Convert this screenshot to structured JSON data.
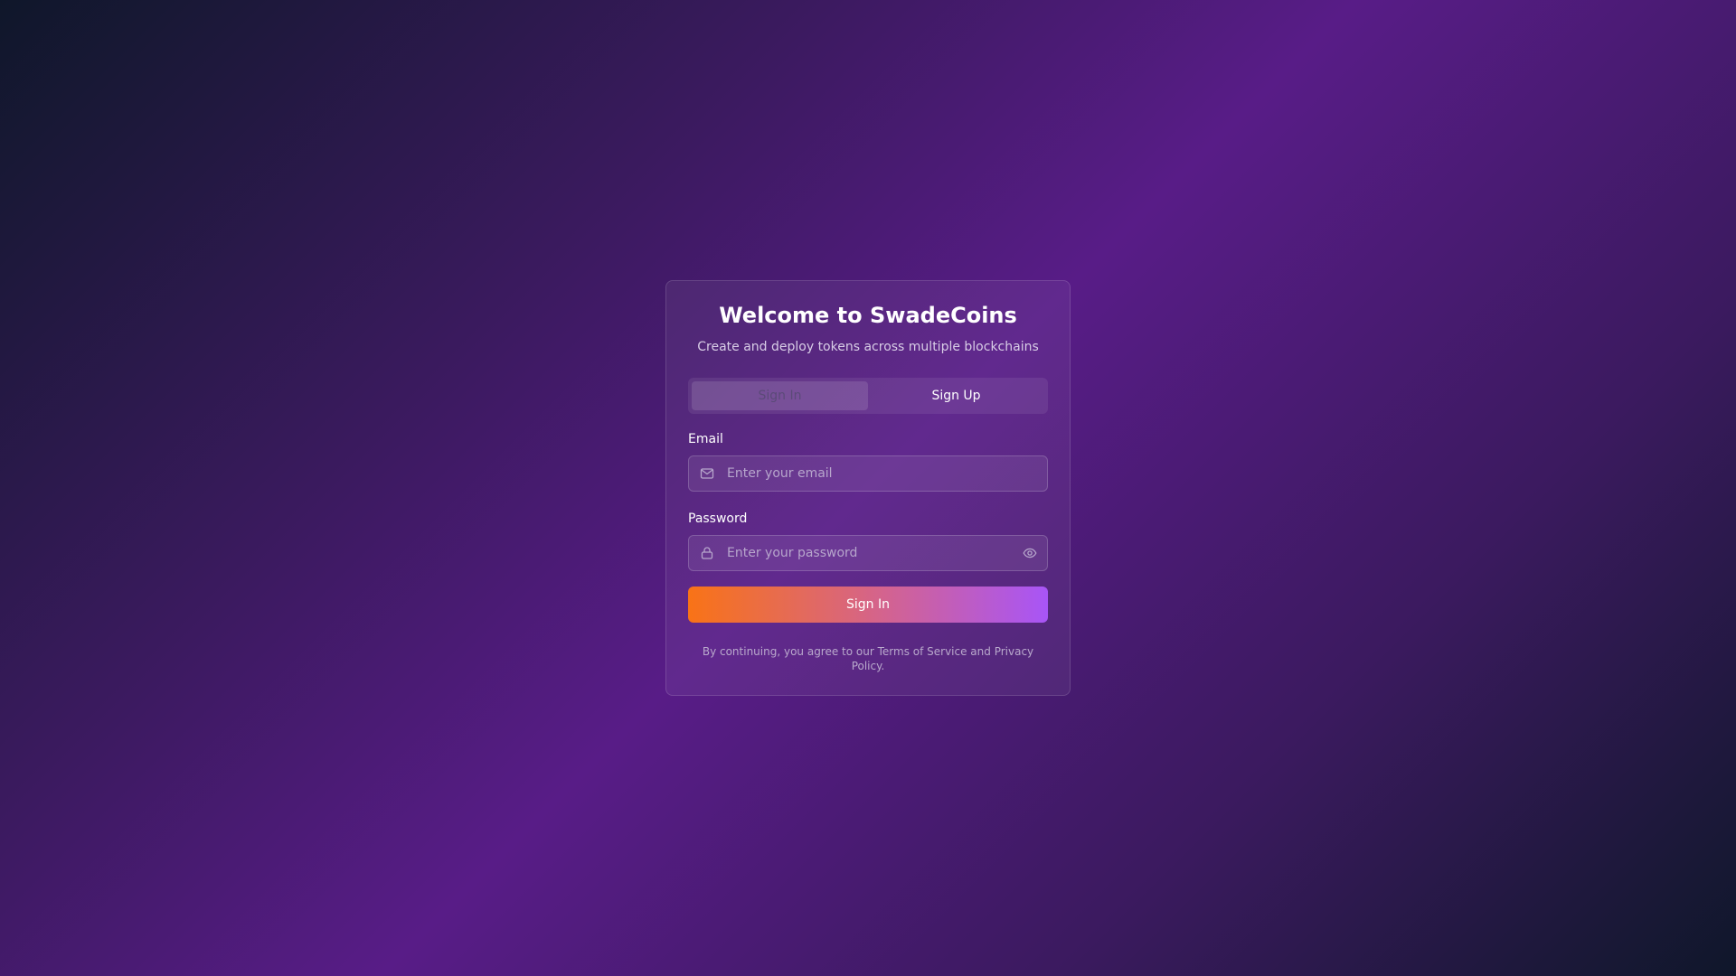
{
  "card": {
    "title": "Welcome to SwadeCoins",
    "subtitle": "Create and deploy tokens across multiple blockchains"
  },
  "tabs": {
    "active": "Sign In",
    "sign_in_label": "Sign In",
    "sign_up_label": "Sign Up"
  },
  "form": {
    "email": {
      "label": "Email",
      "placeholder": "Enter your email",
      "icon": "mail-icon",
      "value": ""
    },
    "password": {
      "label": "Password",
      "placeholder": "Enter your password",
      "icon": "lock-icon",
      "toggle_icon": "eye-icon",
      "value": ""
    },
    "submit_label": "Sign In"
  },
  "legal": {
    "text": "By continuing, you agree to our Terms of Service and Privacy Policy."
  },
  "colors": {
    "accent_start": "#f97316",
    "accent_end": "#a855f7",
    "background_purple": "#581c87",
    "background_dark": "#0f172a"
  }
}
